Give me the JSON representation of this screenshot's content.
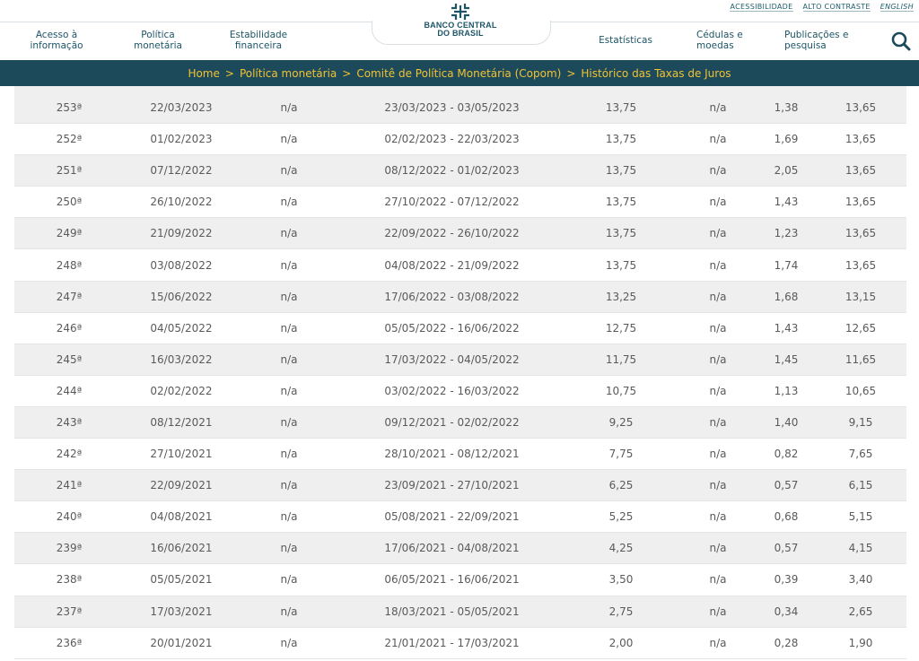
{
  "utility": {
    "accessibility": "ACESSIBILIDADE",
    "contrast": "ALTO CONTRASTE",
    "english": "ENGLISH"
  },
  "nav": {
    "acesso": [
      "Acesso à",
      "informação"
    ],
    "politica": [
      "Política",
      "monetária"
    ],
    "estabilidade": [
      "Estabilidade",
      "financeira"
    ],
    "estatisticas": "Estatísticas",
    "cedulas": [
      "Cédulas e",
      "moedas"
    ],
    "publicacoes": [
      "Publicações e",
      "pesquisa"
    ]
  },
  "logo": {
    "line1": "BANCO CENTRAL",
    "line2": "DO BRASIL"
  },
  "icons": {
    "search": "search-icon",
    "logo": "bcb-logo-icon"
  },
  "breadcrumb": [
    "Home",
    "Política monetária",
    "Comitê de Política Monetária (Copom)",
    "Histórico das Taxas de Juros"
  ],
  "colors": {
    "brand": "#1d4a5b",
    "breadcrumb_text": "#f0c234",
    "row_alt": "#efefef"
  },
  "rows": [
    [
      "253ª",
      "22/03/2023",
      "n/a",
      "23/03/2023 - 03/05/2023",
      "13,75",
      "n/a",
      "1,38",
      "13,65"
    ],
    [
      "252ª",
      "01/02/2023",
      "n/a",
      "02/02/2023 - 22/03/2023",
      "13,75",
      "n/a",
      "1,69",
      "13,65"
    ],
    [
      "251ª",
      "07/12/2022",
      "n/a",
      "08/12/2022 - 01/02/2023",
      "13,75",
      "n/a",
      "2,05",
      "13,65"
    ],
    [
      "250ª",
      "26/10/2022",
      "n/a",
      "27/10/2022 - 07/12/2022",
      "13,75",
      "n/a",
      "1,43",
      "13,65"
    ],
    [
      "249ª",
      "21/09/2022",
      "n/a",
      "22/09/2022 - 26/10/2022",
      "13,75",
      "n/a",
      "1,23",
      "13,65"
    ],
    [
      "248ª",
      "03/08/2022",
      "n/a",
      "04/08/2022 - 21/09/2022",
      "13,75",
      "n/a",
      "1,74",
      "13,65"
    ],
    [
      "247ª",
      "15/06/2022",
      "n/a",
      "17/06/2022 - 03/08/2022",
      "13,25",
      "n/a",
      "1,68",
      "13,15"
    ],
    [
      "246ª",
      "04/05/2022",
      "n/a",
      "05/05/2022 - 16/06/2022",
      "12,75",
      "n/a",
      "1,43",
      "12,65"
    ],
    [
      "245ª",
      "16/03/2022",
      "n/a",
      "17/03/2022 - 04/05/2022",
      "11,75",
      "n/a",
      "1,45",
      "11,65"
    ],
    [
      "244ª",
      "02/02/2022",
      "n/a",
      "03/02/2022 - 16/03/2022",
      "10,75",
      "n/a",
      "1,13",
      "10,65"
    ],
    [
      "243ª",
      "08/12/2021",
      "n/a",
      "09/12/2021 - 02/02/2022",
      "9,25",
      "n/a",
      "1,40",
      "9,15"
    ],
    [
      "242ª",
      "27/10/2021",
      "n/a",
      "28/10/2021 - 08/12/2021",
      "7,75",
      "n/a",
      "0,82",
      "7,65"
    ],
    [
      "241ª",
      "22/09/2021",
      "n/a",
      "23/09/2021 - 27/10/2021",
      "6,25",
      "n/a",
      "0,57",
      "6,15"
    ],
    [
      "240ª",
      "04/08/2021",
      "n/a",
      "05/08/2021 - 22/09/2021",
      "5,25",
      "n/a",
      "0,68",
      "5,15"
    ],
    [
      "239ª",
      "16/06/2021",
      "n/a",
      "17/06/2021 - 04/08/2021",
      "4,25",
      "n/a",
      "0,57",
      "4,15"
    ],
    [
      "238ª",
      "05/05/2021",
      "n/a",
      "06/05/2021 - 16/06/2021",
      "3,50",
      "n/a",
      "0,39",
      "3,40"
    ],
    [
      "237ª",
      "17/03/2021",
      "n/a",
      "18/03/2021 - 05/05/2021",
      "2,75",
      "n/a",
      "0,34",
      "2,65"
    ],
    [
      "236ª",
      "20/01/2021",
      "n/a",
      "21/01/2021 - 17/03/2021",
      "2,00",
      "n/a",
      "0,28",
      "1,90"
    ]
  ]
}
